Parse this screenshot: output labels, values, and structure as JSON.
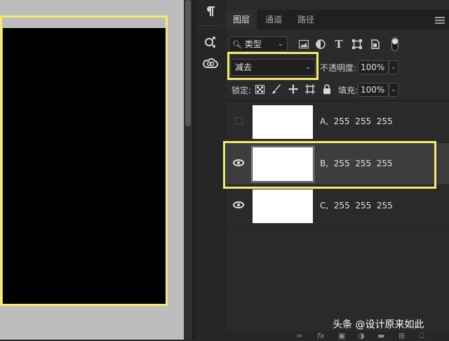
{
  "panel": {
    "tabs": [
      {
        "label": "图层",
        "active": true
      },
      {
        "label": "通道",
        "active": false
      },
      {
        "label": "路径",
        "active": false
      }
    ]
  },
  "filter": {
    "kind_value": "类型",
    "icons": [
      "image-filter-icon",
      "adjustment-filter-icon",
      "type-filter-icon",
      "shape-filter-icon",
      "smart-object-filter-icon",
      "filter-toggle-icon"
    ]
  },
  "blend": {
    "mode": "减去",
    "opacity_label": "不透明度:",
    "opacity_value": "100%"
  },
  "lock": {
    "label": "锁定:",
    "icons": [
      "lock-transparency-icon",
      "lock-pixels-icon",
      "lock-position-icon",
      "lock-artboard-icon",
      "lock-all-icon"
    ],
    "fill_label": "填充:",
    "fill_value": "100%"
  },
  "layers": [
    {
      "name": "A,  255  255  255",
      "visible": false,
      "selected": false
    },
    {
      "name": "B,  255  255  255",
      "visible": true,
      "selected": true
    },
    {
      "name": "C,  255  255  255",
      "visible": true,
      "selected": false
    }
  ],
  "watermark": "头条 @设计原来如此",
  "colors": {
    "highlight": "#f4ec6a",
    "panel_bg": "#2a2a2a",
    "selected_row": "#3d3d3d",
    "canvas_bg": "#bdbdbd",
    "document": "#000000",
    "thumbnail": "#ffffff"
  }
}
